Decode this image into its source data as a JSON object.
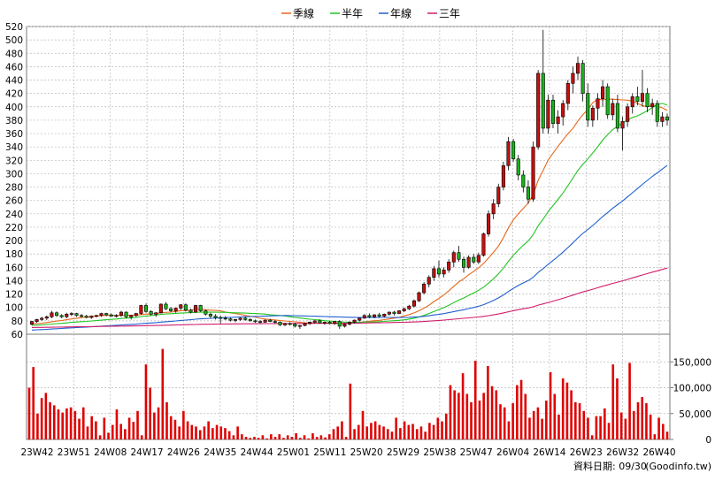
{
  "chart_data": {
    "type": "candlestick",
    "legend": [
      {
        "label": "季線",
        "color": "#e8671b"
      },
      {
        "label": "半年",
        "color": "#22c522"
      },
      {
        "label": "年線",
        "color": "#1f5fcf"
      },
      {
        "label": "三年",
        "color": "#d01d6d"
      }
    ],
    "legend_position": "top-center",
    "price_axis": {
      "min": 60,
      "max": 520,
      "ticks": [
        80,
        100,
        120,
        140,
        160,
        180,
        200,
        220,
        240,
        260,
        280,
        300,
        320,
        340,
        360,
        380,
        400,
        420,
        440,
        460,
        480,
        500,
        520
      ],
      "extra_labels": [
        60
      ]
    },
    "volume_axis": {
      "min": 0,
      "max": 200000,
      "ticks": [
        0,
        50000,
        100000,
        150000
      ],
      "tick_labels": [
        "0",
        "50,000",
        "100,000",
        "150,000"
      ]
    },
    "x_ticks": [
      "23W42",
      "23W51",
      "24W08",
      "24W17",
      "24W26",
      "24W35",
      "24W44",
      "25W01",
      "25W11",
      "25W20",
      "25W29",
      "25W38",
      "25W47",
      "26W04",
      "26W14",
      "26W23",
      "26W32",
      "26W40"
    ],
    "grid": true,
    "footer": "資料日期: 09/30",
    "source": "(Goodinfo.tw)",
    "candles": [
      [
        75,
        80,
        73,
        79
      ],
      [
        79,
        83,
        77,
        82
      ],
      [
        82,
        86,
        80,
        84
      ],
      [
        84,
        88,
        81,
        86
      ],
      [
        86,
        95,
        84,
        92
      ],
      [
        92,
        94,
        86,
        88
      ],
      [
        88,
        90,
        84,
        86
      ],
      [
        86,
        92,
        84,
        90
      ],
      [
        90,
        93,
        87,
        91
      ],
      [
        91,
        92,
        86,
        88
      ],
      [
        88,
        90,
        85,
        87
      ],
      [
        87,
        89,
        84,
        85
      ],
      [
        85,
        88,
        83,
        87
      ],
      [
        87,
        89,
        85,
        88
      ],
      [
        88,
        92,
        86,
        91
      ],
      [
        91,
        92,
        87,
        89
      ],
      [
        89,
        91,
        86,
        87
      ],
      [
        87,
        90,
        85,
        88
      ],
      [
        88,
        95,
        86,
        93
      ],
      [
        93,
        94,
        84,
        86
      ],
      [
        86,
        89,
        82,
        88
      ],
      [
        88,
        92,
        86,
        91
      ],
      [
        91,
        104,
        89,
        103
      ],
      [
        103,
        106,
        92,
        94
      ],
      [
        94,
        96,
        88,
        90
      ],
      [
        90,
        93,
        86,
        92
      ],
      [
        92,
        106,
        91,
        105
      ],
      [
        105,
        108,
        96,
        98
      ],
      [
        98,
        101,
        93,
        95
      ],
      [
        95,
        100,
        92,
        99
      ],
      [
        99,
        105,
        96,
        104
      ],
      [
        104,
        106,
        94,
        96
      ],
      [
        96,
        98,
        91,
        93
      ],
      [
        93,
        104,
        92,
        103
      ],
      [
        103,
        104,
        93,
        95
      ],
      [
        95,
        97,
        88,
        90
      ],
      [
        90,
        92,
        84,
        87
      ],
      [
        87,
        90,
        82,
        85
      ],
      [
        85,
        88,
        76,
        84
      ],
      [
        84,
        87,
        81,
        83
      ],
      [
        83,
        85,
        79,
        81
      ],
      [
        81,
        83,
        78,
        82
      ],
      [
        82,
        85,
        80,
        84
      ],
      [
        84,
        86,
        80,
        82
      ],
      [
        82,
        84,
        79,
        80
      ],
      [
        80,
        82,
        77,
        79
      ],
      [
        79,
        81,
        76,
        78
      ],
      [
        78,
        82,
        77,
        81
      ],
      [
        81,
        83,
        78,
        79
      ],
      [
        79,
        81,
        76,
        78
      ],
      [
        78,
        79,
        72,
        74
      ],
      [
        74,
        77,
        72,
        76
      ],
      [
        76,
        78,
        73,
        75
      ],
      [
        75,
        77,
        70,
        72
      ],
      [
        72,
        74,
        68,
        73
      ],
      [
        73,
        77,
        72,
        76
      ],
      [
        76,
        79,
        74,
        78
      ],
      [
        78,
        81,
        76,
        80
      ],
      [
        80,
        82,
        76,
        77
      ],
      [
        77,
        79,
        74,
        78
      ],
      [
        78,
        80,
        75,
        76
      ],
      [
        76,
        80,
        74,
        79
      ],
      [
        79,
        81,
        68,
        72
      ],
      [
        72,
        76,
        70,
        75
      ],
      [
        75,
        79,
        73,
        78
      ],
      [
        78,
        82,
        76,
        81
      ],
      [
        81,
        85,
        79,
        84
      ],
      [
        84,
        90,
        83,
        88
      ],
      [
        88,
        91,
        84,
        86
      ],
      [
        86,
        90,
        84,
        89
      ],
      [
        89,
        92,
        85,
        87
      ],
      [
        87,
        91,
        85,
        90
      ],
      [
        90,
        94,
        88,
        93
      ],
      [
        93,
        95,
        88,
        91
      ],
      [
        91,
        96,
        90,
        95
      ],
      [
        95,
        100,
        93,
        98
      ],
      [
        98,
        104,
        96,
        102
      ],
      [
        102,
        112,
        100,
        110
      ],
      [
        110,
        124,
        108,
        122
      ],
      [
        122,
        138,
        120,
        135
      ],
      [
        135,
        148,
        130,
        145
      ],
      [
        145,
        162,
        140,
        158
      ],
      [
        158,
        170,
        145,
        150
      ],
      [
        150,
        160,
        145,
        156
      ],
      [
        156,
        172,
        152,
        168
      ],
      [
        168,
        185,
        160,
        182
      ],
      [
        182,
        192,
        168,
        172
      ],
      [
        172,
        176,
        152,
        160
      ],
      [
        160,
        178,
        158,
        175
      ],
      [
        175,
        180,
        165,
        168
      ],
      [
        168,
        182,
        165,
        178
      ],
      [
        178,
        212,
        176,
        210
      ],
      [
        210,
        245,
        206,
        240
      ],
      [
        240,
        262,
        232,
        255
      ],
      [
        255,
        285,
        250,
        280
      ],
      [
        280,
        318,
        275,
        312
      ],
      [
        312,
        355,
        305,
        348
      ],
      [
        348,
        352,
        318,
        322
      ],
      [
        322,
        328,
        290,
        298
      ],
      [
        298,
        305,
        272,
        280
      ],
      [
        280,
        290,
        255,
        262
      ],
      [
        262,
        348,
        258,
        340
      ],
      [
        340,
        455,
        336,
        450
      ],
      [
        450,
        515,
        360,
        368
      ],
      [
        368,
        418,
        360,
        410
      ],
      [
        410,
        418,
        368,
        375
      ],
      [
        375,
        395,
        360,
        385
      ],
      [
        385,
        410,
        372,
        405
      ],
      [
        405,
        440,
        395,
        435
      ],
      [
        435,
        460,
        420,
        450
      ],
      [
        450,
        475,
        440,
        465
      ],
      [
        465,
        470,
        408,
        420
      ],
      [
        420,
        435,
        370,
        380
      ],
      [
        380,
        402,
        370,
        398
      ],
      [
        398,
        420,
        380,
        412
      ],
      [
        412,
        440,
        400,
        430
      ],
      [
        430,
        435,
        382,
        388
      ],
      [
        388,
        412,
        380,
        405
      ],
      [
        405,
        418,
        362,
        368
      ],
      [
        368,
        385,
        335,
        378
      ],
      [
        378,
        405,
        370,
        400
      ],
      [
        400,
        420,
        390,
        415
      ],
      [
        415,
        430,
        402,
        408
      ],
      [
        408,
        455,
        400,
        420
      ],
      [
        420,
        428,
        392,
        400
      ],
      [
        400,
        412,
        388,
        405
      ],
      [
        405,
        410,
        370,
        378
      ],
      [
        378,
        392,
        370,
        385
      ],
      [
        385,
        390,
        372,
        380
      ]
    ],
    "volume": [
      100000,
      140000,
      50000,
      80000,
      90000,
      72000,
      66000,
      58000,
      52000,
      60000,
      62000,
      55000,
      40000,
      62000,
      25000,
      45000,
      35000,
      8000,
      42000,
      13000,
      28000,
      58000,
      30000,
      20000,
      42000,
      34000,
      55000,
      8000,
      145000,
      100000,
      52000,
      62000,
      175000,
      72000,
      45000,
      38000,
      25000,
      55000,
      35000,
      28000,
      25000,
      18000,
      25000,
      35000,
      22000,
      28000,
      25000,
      22000,
      16000,
      8000,
      25000,
      10000,
      5000,
      3000,
      5000,
      3000,
      8000,
      2000,
      10000,
      5000,
      10000,
      3000,
      8000,
      5000,
      12000,
      3000,
      8000,
      2000,
      12000,
      5000,
      8000,
      4000,
      10000,
      20000,
      25000,
      35000,
      5000,
      108000,
      20000,
      28000,
      55000,
      25000,
      32000,
      35000,
      28000,
      25000,
      20000,
      15000,
      42000,
      22000,
      35000,
      28000,
      30000,
      20000,
      25000,
      15000,
      32000,
      28000,
      42000,
      35000,
      50000,
      105000,
      95000,
      90000,
      128000,
      88000,
      72000,
      152000,
      75000,
      90000,
      142000,
      103000,
      95000,
      68000,
      62000,
      35000,
      70000,
      105000,
      115000,
      88000,
      42000,
      55000,
      62000,
      40000,
      75000,
      130000,
      88000,
      48000,
      118000,
      110000,
      95000,
      72000,
      70000,
      55000,
      42000,
      8000,
      45000,
      45000,
      60000,
      32000,
      145000,
      118000,
      52000,
      40000,
      148000,
      55000,
      72000,
      82000,
      70000,
      48000,
      10000,
      42000,
      30000,
      15000
    ]
  }
}
